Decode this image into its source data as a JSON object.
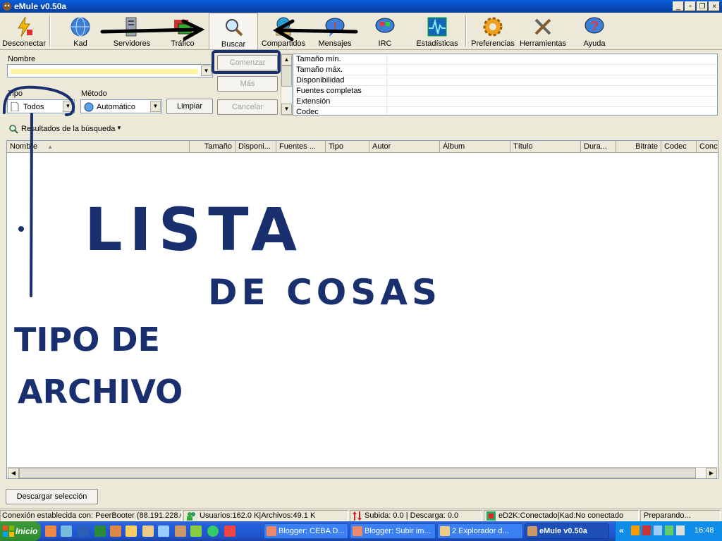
{
  "window": {
    "title": "eMule v0.50a"
  },
  "toolbar": {
    "items": [
      {
        "label": "Desconectar",
        "icon": "lightning-disconnect-icon"
      },
      {
        "label": "Kad",
        "icon": "globe-icon"
      },
      {
        "label": "Servidores",
        "icon": "server-icon"
      },
      {
        "label": "Tráfico",
        "icon": "transfer-icon"
      },
      {
        "label": "Buscar",
        "icon": "search-magnifier-icon"
      },
      {
        "label": "Compartidos",
        "icon": "shared-files-icon"
      },
      {
        "label": "Mensajes",
        "icon": "message-bubble-icon"
      },
      {
        "label": "IRC",
        "icon": "irc-chat-icon"
      },
      {
        "label": "Estadísticas",
        "icon": "statistics-pulse-icon"
      },
      {
        "label": "Preferencias",
        "icon": "gear-icon"
      },
      {
        "label": "Herramientas",
        "icon": "tools-icon"
      },
      {
        "label": "Ayuda",
        "icon": "help-icon"
      }
    ]
  },
  "search": {
    "name_label": "Nombre",
    "name_value": "",
    "type_label": "Tipo",
    "type_value": "Todos",
    "method_label": "Método",
    "method_value": "Automático",
    "start_button": "Comenzar",
    "more_button": "Más",
    "clear_button": "Limpiar",
    "cancel_button": "Cancelar",
    "params": [
      "Tamaño mín.",
      "Tamaño máx.",
      "Disponibilidad",
      "Fuentes completas",
      "Extensión",
      "Codec"
    ]
  },
  "results": {
    "tab_label": "Resultados de la búsqueda",
    "columns": [
      "Nombre",
      "Tamaño",
      "Disponi...",
      "Fuentes ...",
      "Tipo",
      "Autor",
      "Álbum",
      "Título",
      "Dura...",
      "Bitrate",
      "Codec",
      "Conc"
    ]
  },
  "annotations": {
    "lista_line1": "LISTA",
    "lista_line2": "DE COSAS",
    "tipo_line1": "TIPO DE",
    "tipo_line2": "ARCHIVO"
  },
  "download_button": "Descargar selección",
  "status": {
    "connection": "Conexión establecida con: PeerBooter (88.191.228.6",
    "users": "Usuarios:162.0 K|Archivos:49.1 K",
    "transfer": "Subida: 0.0 | Descarga: 0.0",
    "network": "eD2K:Conectado|Kad:No conectado",
    "state": "Preparando..."
  },
  "taskbar": {
    "start": "Inicio",
    "tasks": [
      "Blogger: CEBA D...",
      "Blogger: Subir im...",
      "2 Explorador d...",
      "eMule v0.50a"
    ],
    "clock": "16:48",
    "tray_arrow": "«"
  },
  "colors": {
    "ink": "#1a2f6e",
    "accent": "#0a5fd8"
  }
}
